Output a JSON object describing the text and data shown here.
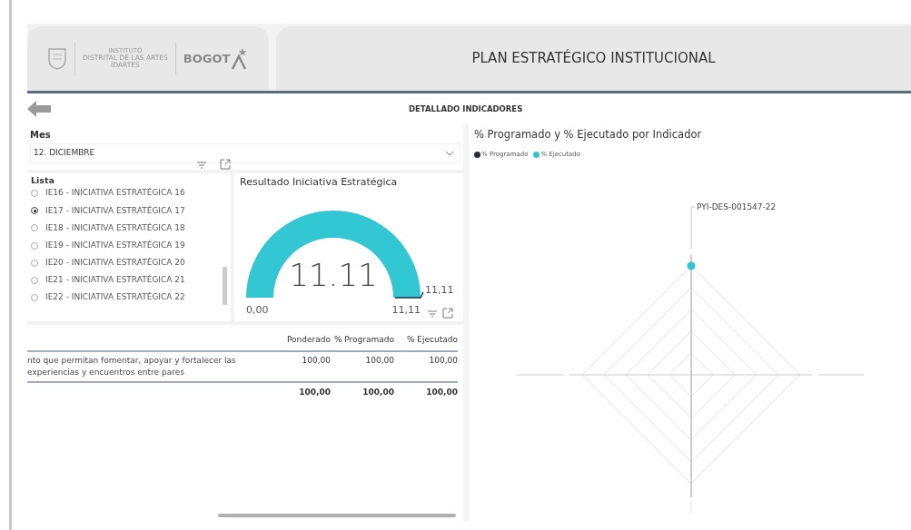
{
  "header": {
    "logo": {
      "institute_small": "INSTITUTO",
      "institute": "DISTRITAL DE LAS ARTES",
      "acronym": "IDARTES",
      "city": "BOGOT"
    },
    "title": "PLAN ESTRATÉGICO INSTITUCIONAL"
  },
  "subheader": {
    "title": "DETALLADO INDICADORES"
  },
  "month_slicer": {
    "label": "Mes",
    "value": "12. DICIEMBRE"
  },
  "list_slicer": {
    "label": "Lista",
    "items": [
      {
        "label": "IE16 - INICIATIVA ESTRATÉGICA 16",
        "selected": false
      },
      {
        "label": "IE17 - INICIATIVA ESTRATÉGICA 17",
        "selected": true
      },
      {
        "label": "IE18 - INICIATIVA ESTRATÉGICA 18",
        "selected": false
      },
      {
        "label": "IE19 - INICIATIVA ESTRATÉGICA 19",
        "selected": false
      },
      {
        "label": "IE20 - INICIATIVA ESTRATÉGICA 20",
        "selected": false
      },
      {
        "label": "IE21 - INICIATIVA ESTRATÉGICA 21",
        "selected": false
      },
      {
        "label": "IE22 - INICIATIVA ESTRATÉGICA 22",
        "selected": false
      }
    ]
  },
  "gauge": {
    "title": "Resultado Iniciativa Estratégica",
    "value": "11.11",
    "min": "0,00",
    "max": "11,11",
    "target": "11,11",
    "level": 1
  },
  "table": {
    "columns": [
      "Ponderado",
      "% Programado",
      "% Ejecutado"
    ],
    "rows": [
      {
        "description": [
          "nto que permitan fomentar, apoyar y fortalecer las",
          "experiencias y encuentros entre pares"
        ],
        "values": [
          "100,00",
          "100,00",
          "100,00"
        ]
      }
    ],
    "totals": [
      "100,00",
      "100,00",
      "100,00"
    ]
  },
  "radar": {
    "title": "% Programado y % Ejecutado por Indicador",
    "legend": [
      {
        "name": "% Programado",
        "color": "#1f2d4a"
      },
      {
        "name": "% Ejecutado",
        "color": "#33c3d3"
      }
    ],
    "axis_label": "PYI-DES-001547-22"
  }
}
